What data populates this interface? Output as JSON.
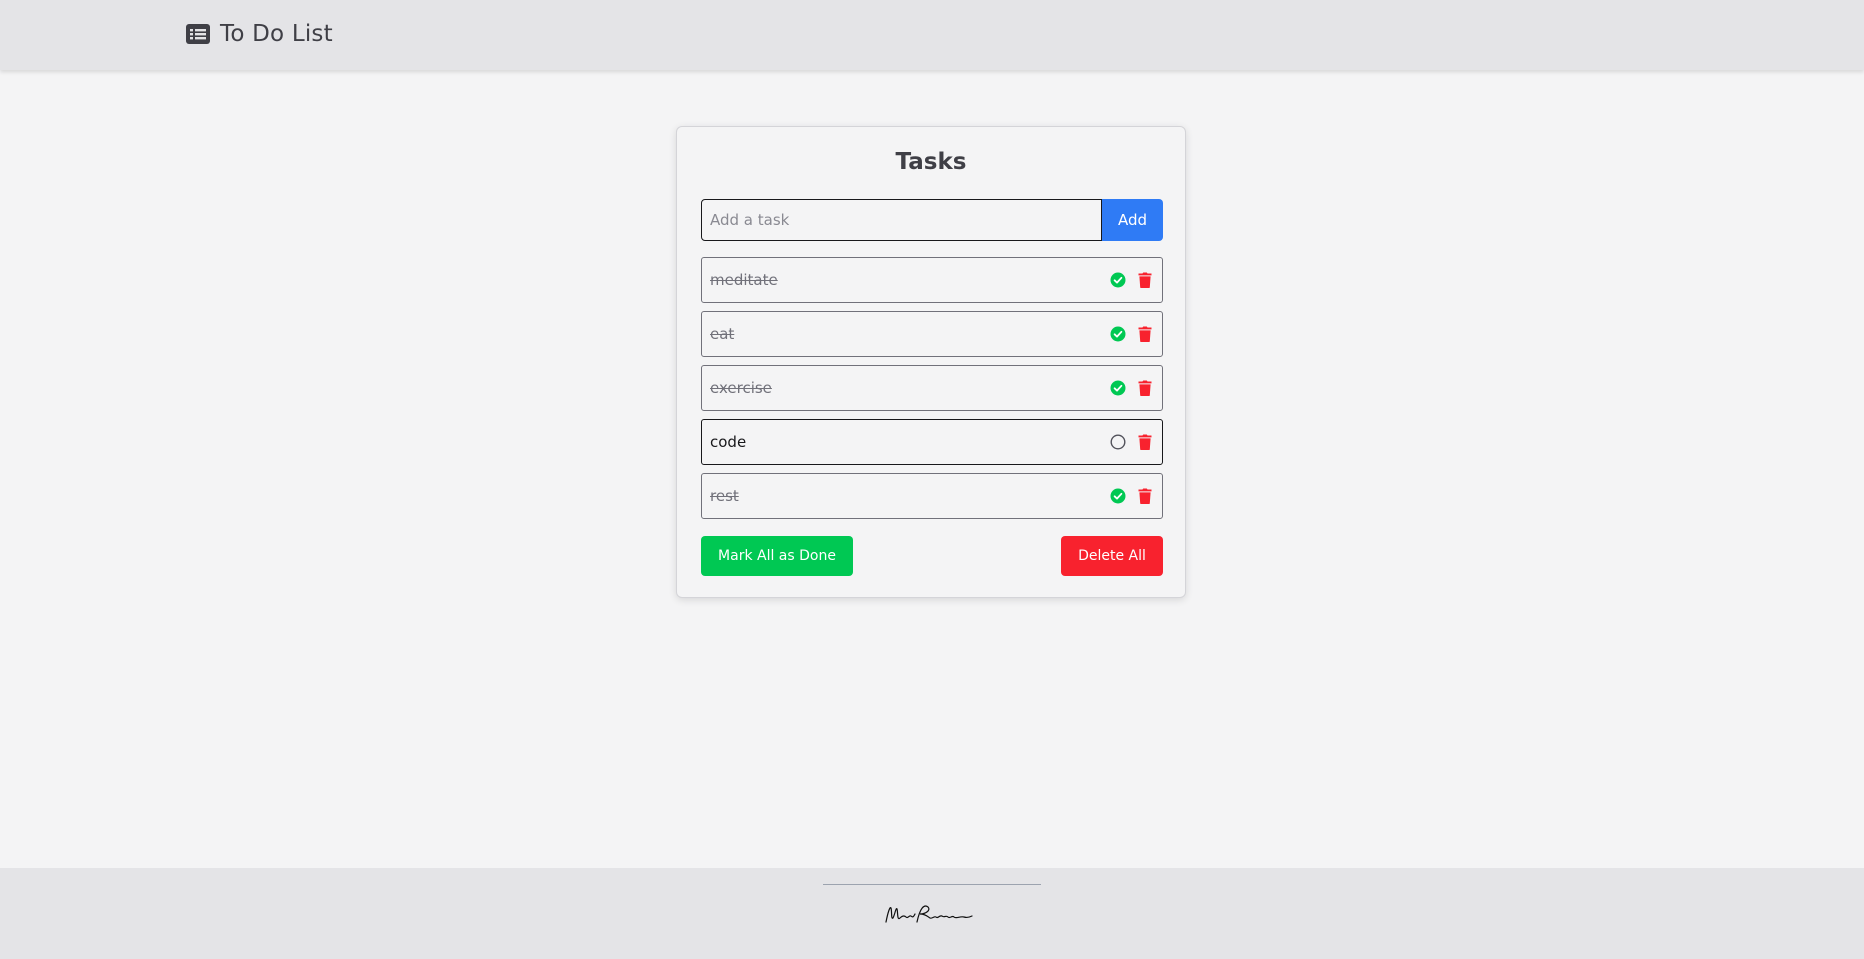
{
  "navbar": {
    "title": "To Do List",
    "icon": "list-card-icon"
  },
  "tasks_card": {
    "title": "Tasks",
    "input": {
      "placeholder": "Add a task",
      "value": ""
    },
    "add_label": "Add",
    "items": [
      {
        "text": "meditate",
        "done": true
      },
      {
        "text": "eat",
        "done": true
      },
      {
        "text": "exercise",
        "done": true
      },
      {
        "text": "code",
        "done": false
      },
      {
        "text": "rest",
        "done": true
      }
    ],
    "mark_all_label": "Mark All as Done",
    "delete_all_label": "Delete All"
  },
  "icons": {
    "done": "check-circle-icon",
    "not_done": "empty-circle-icon",
    "delete": "trash-icon"
  },
  "colors": {
    "done_green": "#00c853",
    "delete_red": "#f8222e",
    "add_blue": "#2f7bf5",
    "navbar_bg": "#e4e4e7"
  }
}
